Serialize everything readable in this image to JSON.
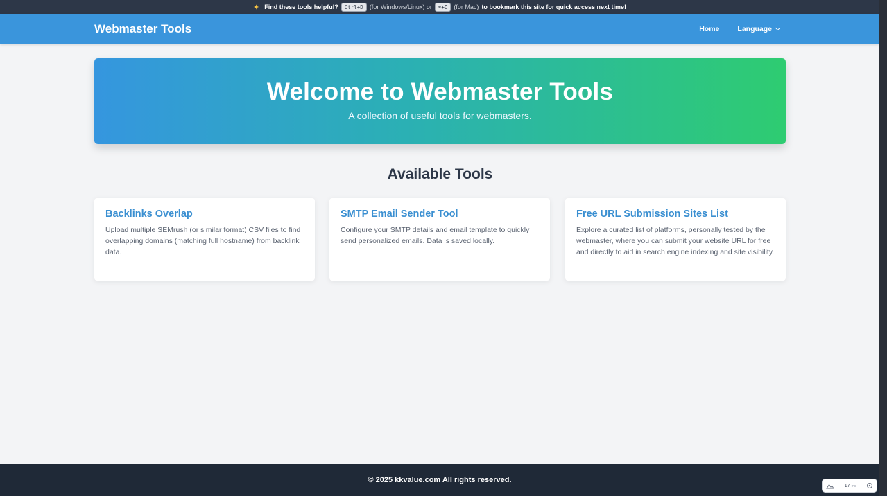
{
  "notice": {
    "prefix": "Find these tools helpful?",
    "shortcut_win": "Ctrl+D",
    "win_note": "(for Windows/Linux) or",
    "shortcut_mac": "⌘+D",
    "mac_note": "(for Mac)",
    "suffix": "to bookmark this site for quick access next time!"
  },
  "navbar": {
    "brand": "Webmaster Tools",
    "links": [
      {
        "label": "Home"
      },
      {
        "label": "Language"
      }
    ]
  },
  "hero": {
    "title": "Welcome to Webmaster Tools",
    "subtitle": "A collection of useful tools for webmasters."
  },
  "tools": {
    "heading": "Available Tools",
    "cards": [
      {
        "title": "Backlinks Overlap",
        "description": "Upload multiple SEMrush (or similar format) CSV files to find overlapping domains (matching full hostname) from backlink data."
      },
      {
        "title": "SMTP Email Sender Tool",
        "description": "Configure your SMTP details and email template to quickly send personalized emails. Data is saved locally."
      },
      {
        "title": "Free URL Submission Sites List",
        "description": "Explore a curated list of platforms, personally tested by the webmaster, where you can submit your website URL for free and directly to aid in search engine indexing and site visibility."
      }
    ]
  },
  "footer": {
    "copyright": "© 2025 kkvalue.com All rights reserved."
  },
  "widget": {
    "value": "17",
    "unit": "ms"
  },
  "colors": {
    "navbar": "#3a95dc",
    "hero_start": "#3596df",
    "hero_end": "#2ecc71",
    "card_title": "#3a8fd1",
    "footer": "#1f2937"
  }
}
